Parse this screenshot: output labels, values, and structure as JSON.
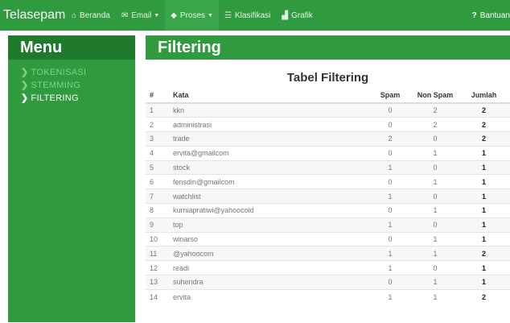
{
  "navbar": {
    "brand": "Telasepam",
    "items": [
      {
        "label": "Beranda",
        "icon": "home-icon",
        "glyph": "⌂"
      },
      {
        "label": "Email",
        "icon": "envelope-icon",
        "glyph": "✉",
        "caret": "▼"
      },
      {
        "label": "Proses",
        "icon": "tag-icon",
        "glyph": "◆",
        "caret": "▼"
      },
      {
        "label": "Klasifikasi",
        "icon": "list-icon",
        "glyph": "☰"
      },
      {
        "label": "Grafik",
        "icon": "chart-icon",
        "glyph": "▟"
      }
    ],
    "help": {
      "label": "Bantuan",
      "glyph": "?"
    }
  },
  "sidebar": {
    "title": "Menu",
    "items": [
      {
        "label": "TOKENISASI"
      },
      {
        "label": "STEMMING"
      },
      {
        "label": "FILTERING"
      }
    ]
  },
  "main": {
    "header": "Filtering",
    "table_title": "Tabel Filtering",
    "columns": [
      "#",
      "Kata",
      "Spam",
      "Non Spam",
      "Jumlah"
    ],
    "rows": [
      {
        "no": "1",
        "kata": "kkn",
        "spam": "0",
        "non_spam": "2",
        "jumlah": "2"
      },
      {
        "no": "2",
        "kata": "administrasi",
        "spam": "0",
        "non_spam": "2",
        "jumlah": "2"
      },
      {
        "no": "3",
        "kata": "trade",
        "spam": "2",
        "non_spam": "0",
        "jumlah": "2"
      },
      {
        "no": "4",
        "kata": "ervita@gmailcom",
        "spam": "0",
        "non_spam": "1",
        "jumlah": "1"
      },
      {
        "no": "5",
        "kata": "stock",
        "spam": "1",
        "non_spam": "0",
        "jumlah": "1"
      },
      {
        "no": "6",
        "kata": "fensdin@gmailcom",
        "spam": "0",
        "non_spam": "1",
        "jumlah": "1"
      },
      {
        "no": "7",
        "kata": "watchlist",
        "spam": "1",
        "non_spam": "0",
        "jumlah": "1"
      },
      {
        "no": "8",
        "kata": "kurniapratiwi@yahoocoid",
        "spam": "0",
        "non_spam": "1",
        "jumlah": "1"
      },
      {
        "no": "9",
        "kata": "top",
        "spam": "1",
        "non_spam": "0",
        "jumlah": "1"
      },
      {
        "no": "10",
        "kata": "winarso",
        "spam": "0",
        "non_spam": "1",
        "jumlah": "1"
      },
      {
        "no": "11",
        "kata": "@yahoocom",
        "spam": "1",
        "non_spam": "1",
        "jumlah": "2"
      },
      {
        "no": "12",
        "kata": "readi",
        "spam": "1",
        "non_spam": "0",
        "jumlah": "1"
      },
      {
        "no": "13",
        "kata": "suhendra",
        "spam": "0",
        "non_spam": "1",
        "jumlah": "1"
      },
      {
        "no": "14",
        "kata": "ervita",
        "spam": "1",
        "non_spam": "1",
        "jumlah": "2"
      }
    ]
  },
  "colors": {
    "primary": "#2f9a3e",
    "primary_dark": "#1f7a2e",
    "sidebar_link": "#7fd18a"
  }
}
